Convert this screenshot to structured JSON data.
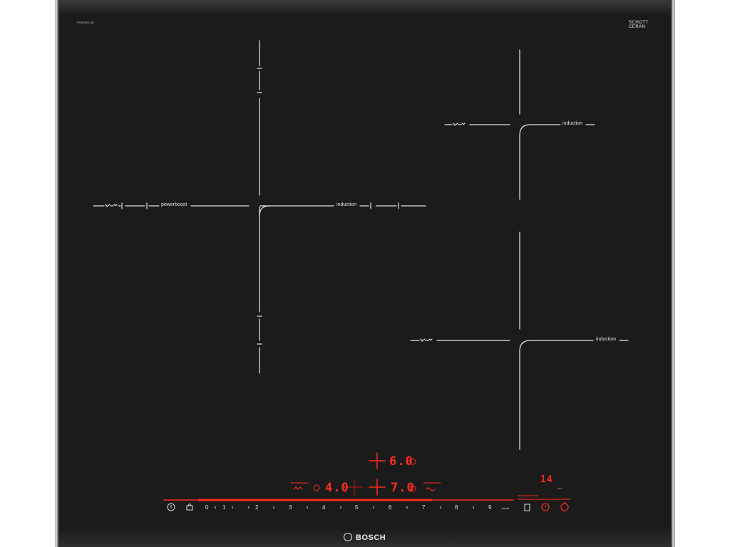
{
  "cooktop": {
    "model": "PID675DC1E",
    "glass_brand_line1": "SCHOTT",
    "glass_brand_line2": "CERAN",
    "brand": "BOSCH"
  },
  "zones": {
    "left_powerboost_label": "powerboost",
    "left_induction_label": "induction",
    "right_top_induction_label": "induction",
    "right_bottom_induction_label": "induction",
    "flex_icon": "flex-zone-icon"
  },
  "display": {
    "top_zone_level": "6.0",
    "left_zone_level": "4.0",
    "right_zone_level": "7.0",
    "timer_value": "14",
    "timer_unit": "min"
  },
  "control_bar": {
    "power_icon": "power-icon",
    "child_lock_icon": "child-lock-icon",
    "scale": [
      "0",
      "1",
      "2",
      "3",
      "4",
      "5",
      "6",
      "7",
      "8",
      "9"
    ],
    "boost_label": "boost",
    "wipe_protect_icon": "wipe-protect-icon",
    "timer_icon": "timer-icon",
    "stopwatch_icon": "stopwatch-icon"
  },
  "colors": {
    "glass": "#1b1b1b",
    "markings": "#e6e6e6",
    "led_red": "#ff2a1f"
  }
}
